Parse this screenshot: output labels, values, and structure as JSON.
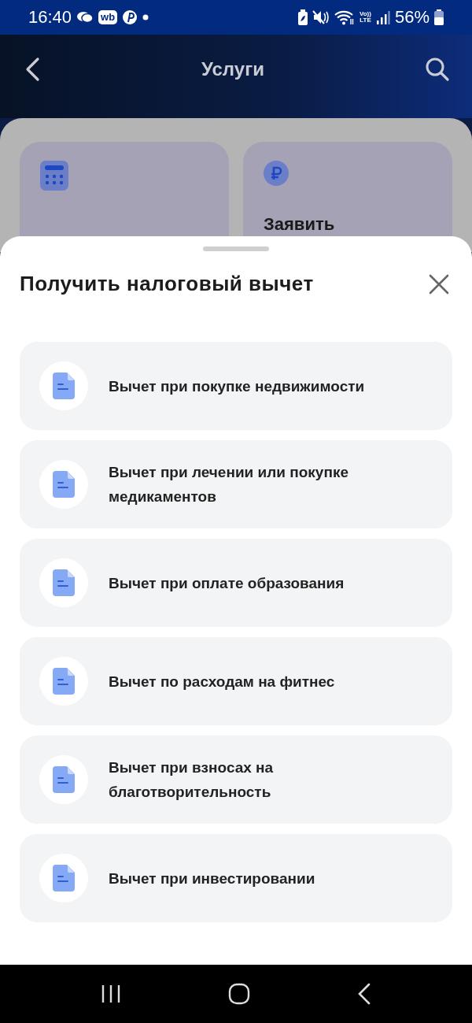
{
  "status_bar": {
    "time": "16:40",
    "app_badge": "wb",
    "volte": [
      "Vo))",
      "LTE"
    ],
    "battery": "56%"
  },
  "header": {
    "title": "Услуги"
  },
  "background_cards": [
    {
      "kind": "calendar"
    },
    {
      "kind": "ruble",
      "label": "Заявить"
    }
  ],
  "sheet": {
    "title": "Получить налоговый вычет",
    "items": [
      {
        "label": "Вычет при покупке недвижимости"
      },
      {
        "label": "Вычет при лечении или покупке медикаментов"
      },
      {
        "label": "Вычет при оплате образования"
      },
      {
        "label": "Вычет по расходам на фитнес"
      },
      {
        "label": "Вычет при взносах на благотворительность"
      },
      {
        "label": "Вычет при инвестировании"
      }
    ]
  }
}
